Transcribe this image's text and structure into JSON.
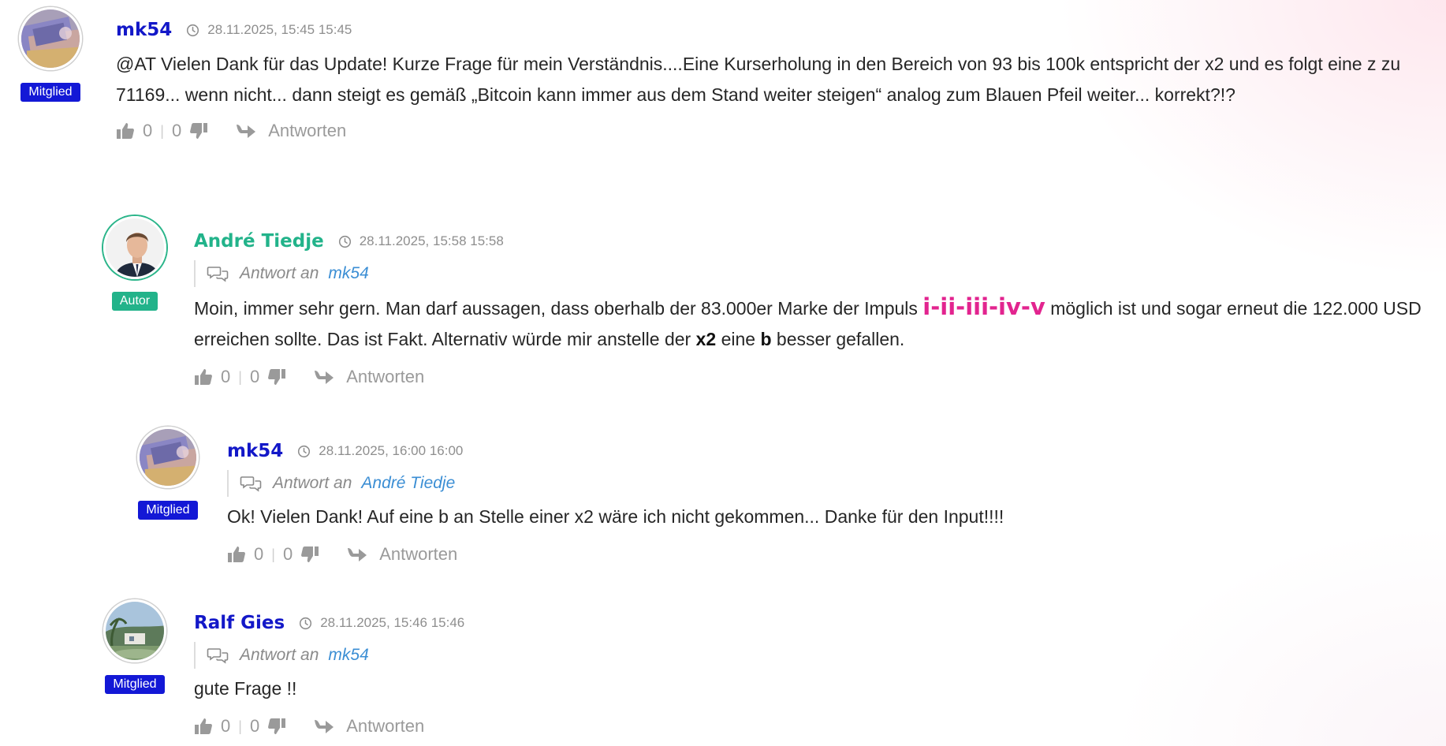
{
  "colors": {
    "member_name": "#1318c8",
    "author_name": "#22b38a",
    "member_badge": "#1318d6",
    "author_badge": "#22b38a",
    "highlight": "#e2248f",
    "link": "#3b8ed4"
  },
  "comments": [
    {
      "author": "mk54",
      "timestamp": "28.11.2025, 15:45 15:45",
      "role": "Mitglied",
      "text": "@AT Vielen Dank für das Update! Kurze Frage für mein Verständnis....Eine Kurserholung in den Bereich von 93 bis 100k entspricht der x2 und es folgt eine z zu 71169... wenn nicht... dann steigt es gemäß „Bitcoin kann immer aus dem Stand weiter steigen“ analog zum Blauen Pfeil weiter... korrekt?!?",
      "likes": "0",
      "dislikes": "0",
      "reply_label": "Antworten"
    },
    {
      "author": "André Tiedje",
      "timestamp": "28.11.2025, 15:58 15:58",
      "role": "Autor",
      "reply_prefix": "Antwort an",
      "reply_target": "mk54",
      "text_parts": {
        "p1": "Moin, immer sehr gern. Man darf aussagen, dass oberhalb der 83.000er Marke der Impuls ",
        "highlight": "i-ii-iii-iv-v",
        "p2": " möglich ist und sogar erneut die 122.000 USD erreichen sollte. Das ist Fakt. Alternativ würde mir anstelle der ",
        "b1": "x2",
        "p3": " eine ",
        "b2": "b",
        "p4": " besser gefallen."
      },
      "likes": "0",
      "dislikes": "0",
      "reply_label": "Antworten"
    },
    {
      "author": "mk54",
      "timestamp": "28.11.2025, 16:00 16:00",
      "role": "Mitglied",
      "reply_prefix": "Antwort an",
      "reply_target": "André Tiedje",
      "text": "Ok! Vielen Dank! Auf eine b an Stelle einer x2 wäre ich nicht gekommen... Danke für den Input!!!!",
      "likes": "0",
      "dislikes": "0",
      "reply_label": "Antworten"
    },
    {
      "author": "Ralf Gies",
      "timestamp": "28.11.2025, 15:46 15:46",
      "role": "Mitglied",
      "reply_prefix": "Antwort an",
      "reply_target": "mk54",
      "text": "gute Frage !!",
      "likes": "0",
      "dislikes": "0",
      "reply_label": "Antworten"
    }
  ]
}
